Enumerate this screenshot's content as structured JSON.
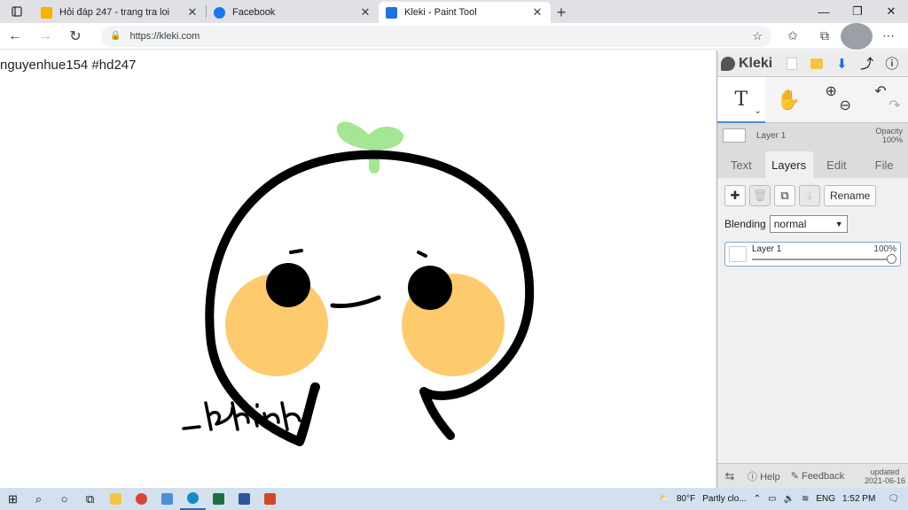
{
  "browser": {
    "tabs": [
      {
        "title": "Hỏi đáp 247 - trang tra loi",
        "favicon_color": "#f4b400",
        "active": false
      },
      {
        "title": "Facebook",
        "favicon_color": "#1877f2",
        "active": false
      },
      {
        "title": "Kleki - Paint Tool",
        "favicon_color": "#1a73e8",
        "active": true
      }
    ],
    "tab_close": "✕",
    "new_tab": "+",
    "url": "https://kleki.com",
    "window_controls": {
      "minimize": "—",
      "maximize": "❐",
      "close": "✕"
    }
  },
  "canvas": {
    "caption": "nguyenhue154 #hd247",
    "colors": {
      "stroke": "#000000",
      "sprout": "#a3e693",
      "cheek": "#fdcb6e"
    }
  },
  "kleki": {
    "logo": "Kleki",
    "layer_header": {
      "name": "Layer 1",
      "opacity_label": "Opacity",
      "opacity_value": "100%"
    },
    "tabs": [
      "Text",
      "Layers",
      "Edit",
      "File"
    ],
    "active_tab": "Layers",
    "tools": {
      "text": "T",
      "hand": "✋"
    },
    "rename_label": "Rename",
    "blending_label": "Blending",
    "blending_value": "normal",
    "layer": {
      "name": "Layer 1",
      "opacity": "100%",
      "opacity_value": 1.0
    },
    "footer": {
      "help": "Help",
      "feedback": "Feedback",
      "updated_label": "updated",
      "updated_date": "2021-06-16"
    }
  },
  "taskbar": {
    "weather_temp": "80°F",
    "weather_text": "Partly clo...",
    "language": "ENG",
    "time": "1:52 PM"
  }
}
